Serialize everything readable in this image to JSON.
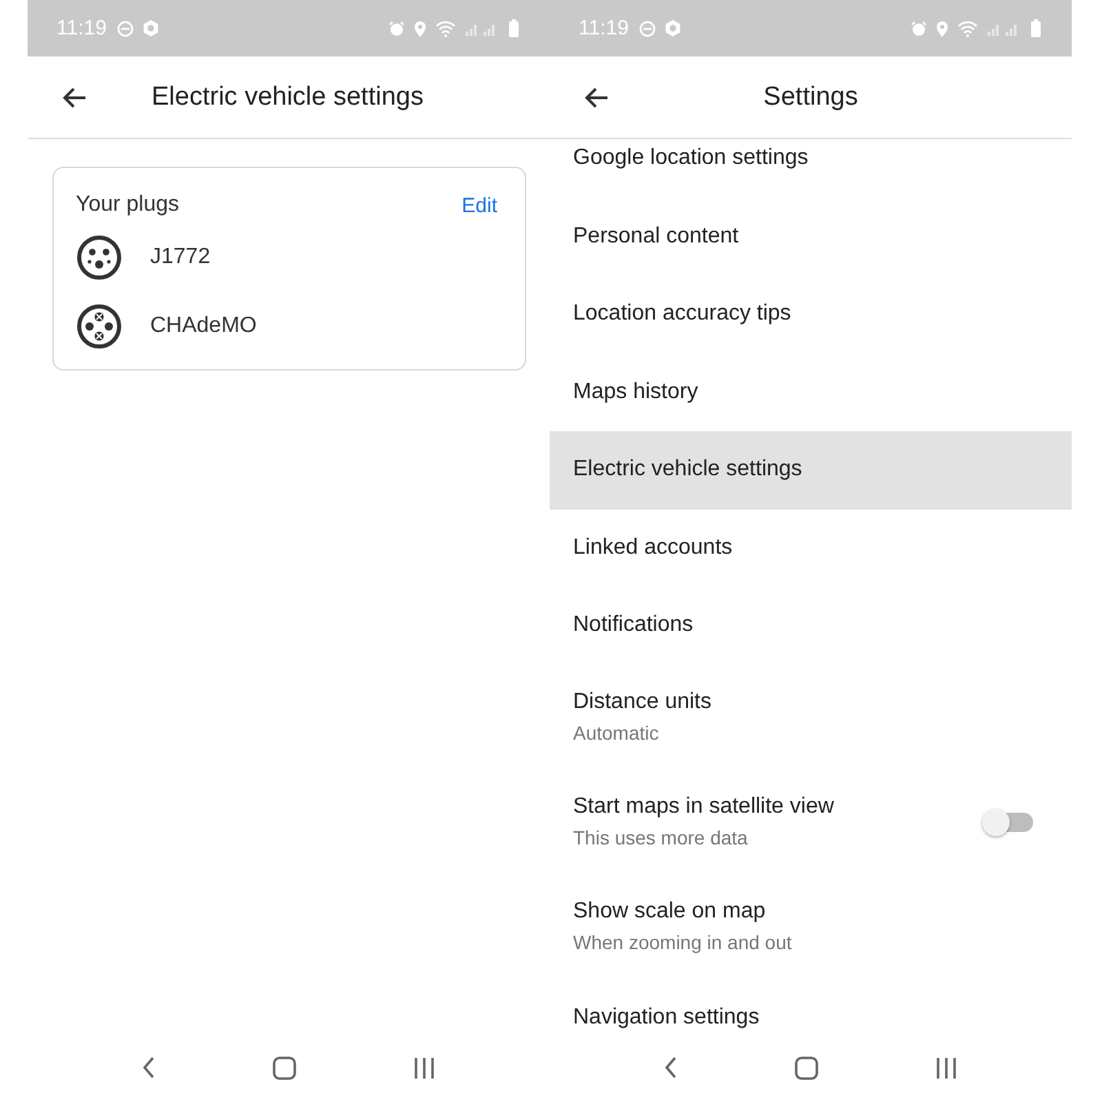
{
  "screens": [
    {
      "status_bar": {
        "time": "11:19"
      },
      "app_bar": {
        "title": "Electric vehicle settings"
      },
      "card": {
        "title": "Your plugs",
        "action": "Edit",
        "plugs": [
          {
            "name": "J1772",
            "kind": "j1772"
          },
          {
            "name": "CHAdeMO",
            "kind": "chademo"
          }
        ]
      }
    },
    {
      "status_bar": {
        "time": "11:19"
      },
      "app_bar": {
        "title": "Settings"
      },
      "items": [
        {
          "kind": "plain",
          "title": "Google location settings",
          "selected": false
        },
        {
          "kind": "plain",
          "title": "Personal content",
          "selected": false
        },
        {
          "kind": "plain",
          "title": "Location accuracy tips",
          "selected": false
        },
        {
          "kind": "plain",
          "title": "Maps history",
          "selected": false
        },
        {
          "kind": "plain",
          "title": "Electric vehicle settings",
          "selected": true
        },
        {
          "kind": "plain",
          "title": "Linked accounts",
          "selected": false
        },
        {
          "kind": "plain",
          "title": "Notifications",
          "selected": false
        },
        {
          "kind": "subtitle",
          "title": "Distance units",
          "subtitle": "Automatic",
          "selected": false
        },
        {
          "kind": "toggle",
          "title": "Start maps in satellite view",
          "subtitle": "This uses more data",
          "on": false,
          "selected": false
        },
        {
          "kind": "subtitle",
          "title": "Show scale on map",
          "subtitle": "When zooming in and out",
          "selected": false
        },
        {
          "kind": "plain",
          "title": "Navigation settings",
          "selected": false
        }
      ]
    }
  ]
}
